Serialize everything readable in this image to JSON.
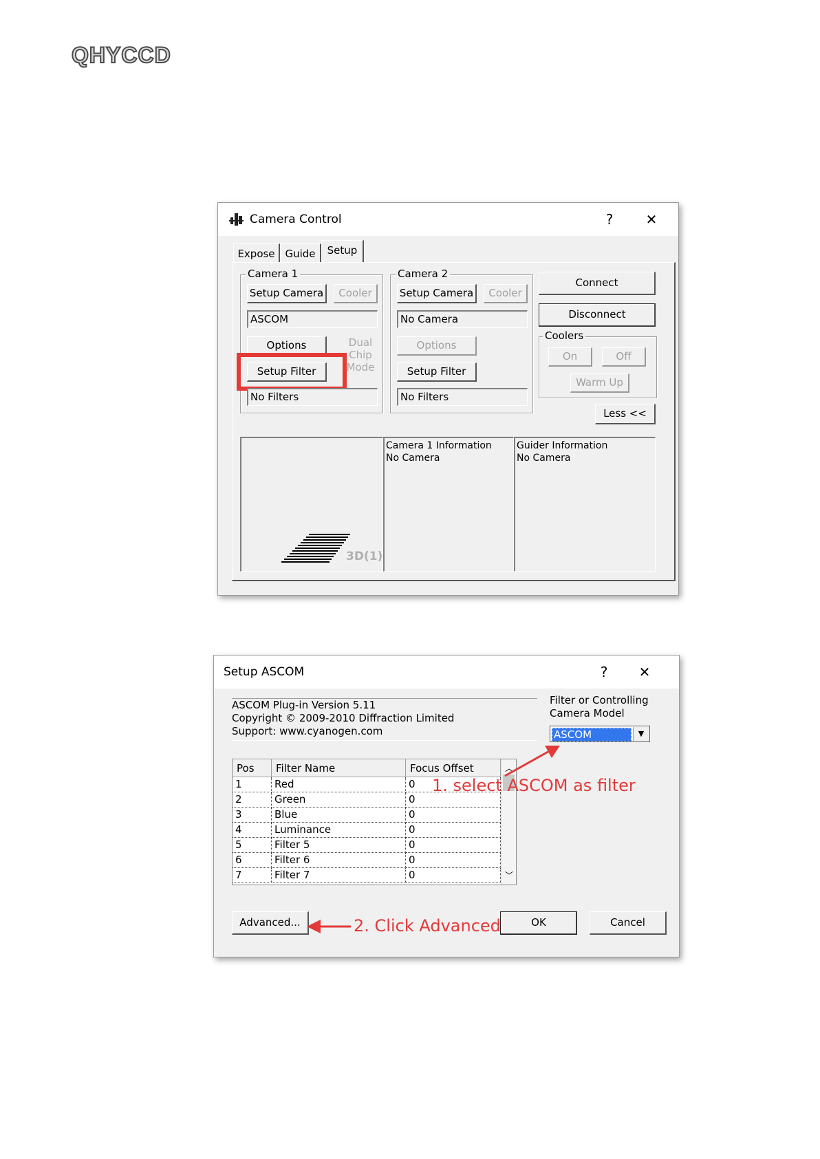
{
  "brand": {
    "logo": "QHYCCD"
  },
  "camera_control": {
    "title": "Camera Control",
    "help": "?",
    "close": "✕",
    "tabs": [
      "Expose",
      "Guide",
      "Setup"
    ],
    "active_tab": "Setup",
    "camera1": {
      "label": "Camera 1",
      "setup_camera": "Setup Camera",
      "cooler": "Cooler",
      "camera_name": "ASCOM",
      "options": "Options",
      "setup_filter": "Setup Filter",
      "filters": "No Filters"
    },
    "dual_chip_mode": "Dual Chip Mode",
    "camera2": {
      "label": "Camera 2",
      "setup_camera": "Setup Camera",
      "cooler": "Cooler",
      "camera_name": "No Camera",
      "options": "Options",
      "setup_filter": "Setup Filter",
      "filters": "No Filters"
    },
    "connect": "Connect",
    "disconnect": "Disconnect",
    "coolers": {
      "label": "Coolers",
      "on": "On",
      "off": "Off",
      "warm_up": "Warm Up"
    },
    "less": "Less <<",
    "preview_label": "3D(1)",
    "camera1_info": {
      "title": "Camera 1 Information",
      "value": "No Camera"
    },
    "guider_info": {
      "title": "Guider Information",
      "value": "No Camera"
    },
    "highlight_color": "#e53935"
  },
  "setup_ascom": {
    "title": "Setup ASCOM",
    "help": "?",
    "close": "✕",
    "info_lines": [
      "ASCOM Plug-in Version 5.11",
      "Copyright © 2009-2010 Diffraction Limited",
      "Support: www.cyanogen.com"
    ],
    "filter_model_label_1": "Filter or Controlling",
    "filter_model_label_2": "Camera Model",
    "filter_model_value": "ASCOM",
    "table": {
      "headers": [
        "Pos",
        "Filter Name",
        "Focus Offset"
      ],
      "rows": [
        [
          "1",
          "Red",
          "0"
        ],
        [
          "2",
          "Green",
          "0"
        ],
        [
          "3",
          "Blue",
          "0"
        ],
        [
          "4",
          "Luminance",
          "0"
        ],
        [
          "5",
          "Filter 5",
          "0"
        ],
        [
          "6",
          "Filter 6",
          "0"
        ],
        [
          "7",
          "Filter 7",
          "0"
        ]
      ]
    },
    "advanced": "Advanced...",
    "ok": "OK",
    "cancel": "Cancel"
  },
  "annotations": {
    "step1": "1. select ASCOM as filter",
    "step2": "2. Click Advanced",
    "color": "#e23a3a"
  }
}
